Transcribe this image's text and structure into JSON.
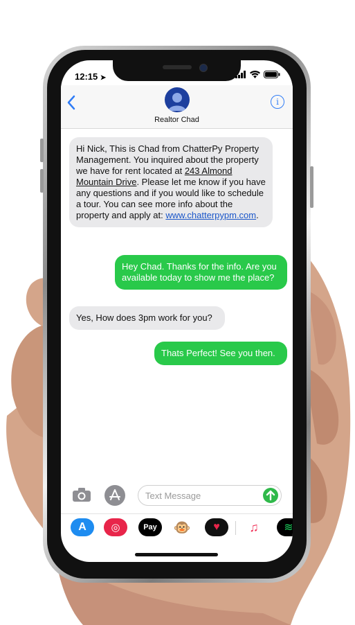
{
  "status": {
    "time": "12:15"
  },
  "header": {
    "contact_name": "Realtor Chad",
    "info_label": "i"
  },
  "messages": [
    {
      "side": "received",
      "parts": [
        "Hi Nick, This is Chad from ChatterPy Property Management. You inquired about the property we have for rent located at ",
        "243 Almond Mountain Drive",
        ". Please let me know if you have any questions and if you would like to schedule a tour. You can see more info about the property and apply at: ",
        "www.chatterpypm.com",
        "."
      ]
    },
    {
      "side": "sent",
      "text": "Hey Chad. Thanks for the info. Are you available today to show me the place?"
    },
    {
      "side": "received",
      "text": "Yes, How does 3pm work for you?"
    },
    {
      "side": "sent",
      "text": "Thats Perfect! See you then."
    }
  ],
  "input": {
    "placeholder": "Text Message"
  },
  "apps": [
    {
      "name": "app-store-icon",
      "glyph": "A",
      "color": "#1e8cf0"
    },
    {
      "name": "search-images-icon",
      "glyph": "◎",
      "color": "#e8254a"
    },
    {
      "name": "apple-pay-icon",
      "glyph": "Pay",
      "color": "#000000"
    },
    {
      "name": "monkey-memoji-icon",
      "glyph": "🐵",
      "color": "#ffffff"
    },
    {
      "name": "digital-touch-icon",
      "glyph": "♥",
      "color": "#111111"
    },
    {
      "name": "music-icon",
      "glyph": "♫",
      "color": "#ffffff"
    },
    {
      "name": "spotify-icon",
      "glyph": "≋",
      "color": "#000000"
    }
  ],
  "colors": {
    "sent_bubble": "#29c94a",
    "received_bubble": "#e9e9eb",
    "ios_blue": "#2f7cf6"
  }
}
